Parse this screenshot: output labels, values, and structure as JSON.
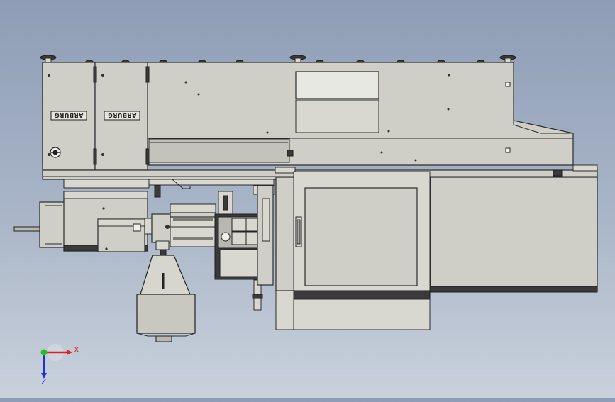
{
  "viewport": {
    "background_top": "#8e9db6",
    "background_bottom": "#c9d1dc",
    "model_color": "#cfcfc7",
    "edge_color": "#2c2c2c"
  },
  "cabinet": {
    "logo_left": "ARBURG",
    "logo_right": "ARBURG"
  },
  "triad": {
    "x_label": "X",
    "z_label": "Z",
    "x_color": "#e02020",
    "y_color": "#20c020",
    "z_color": "#2030d0"
  }
}
